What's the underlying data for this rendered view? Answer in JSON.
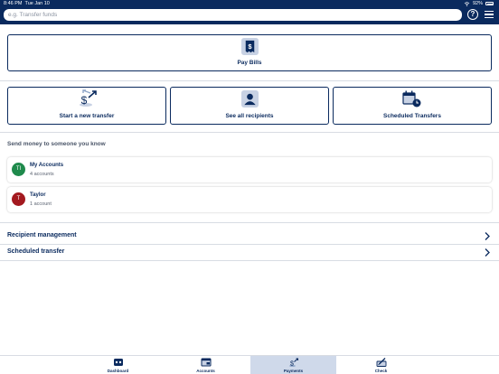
{
  "status": {
    "time": "8:46 PM",
    "date": "Tue Jan 10",
    "battery": "92%"
  },
  "search": {
    "placeholder": "e.g. Transfer funds"
  },
  "actions": {
    "pay_bills": "Pay Bills",
    "new_transfer": "Start a new transfer",
    "all_recipients": "See all recipients",
    "scheduled": "Scheduled Transfers"
  },
  "section_title": "Send money to someone you know",
  "contacts": [
    {
      "initials": "TI",
      "name": "My Accounts",
      "sub": "4 accounts",
      "color": "#1f8a4c"
    },
    {
      "initials": "T",
      "name": "Taylor",
      "sub": "1 account",
      "color": "#a3191f"
    }
  ],
  "links": {
    "recipient_management": "Recipient management",
    "scheduled_transfer": "Scheduled transfer"
  },
  "tabs": [
    {
      "label": "Dashboard",
      "icon": "dashboard-icon"
    },
    {
      "label": "Accounts",
      "icon": "accounts-icon"
    },
    {
      "label": "Payments",
      "icon": "payments-icon",
      "active": true
    },
    {
      "label": "Check",
      "icon": "check-icon"
    }
  ],
  "colors": {
    "brand": "#0a2a5e",
    "tab_active": "#cfd9ea"
  }
}
